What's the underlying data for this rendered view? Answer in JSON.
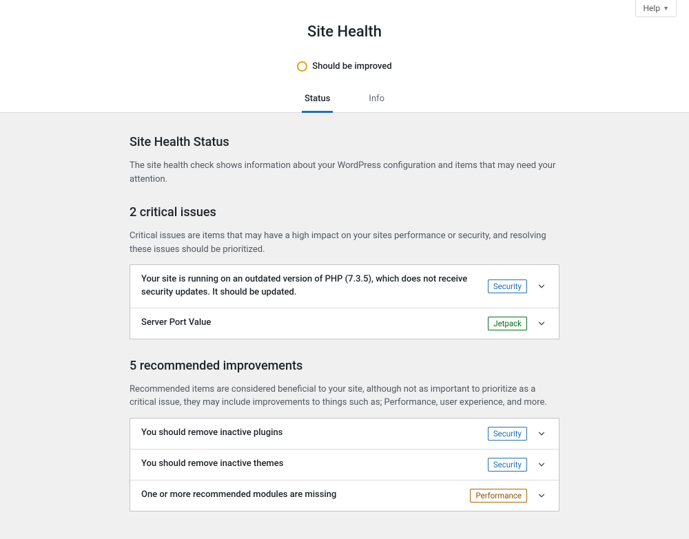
{
  "help_label": "Help",
  "page_title": "Site Health",
  "status_label": "Should be improved",
  "tabs": {
    "status": "Status",
    "info": "Info"
  },
  "sections": {
    "overview": {
      "title": "Site Health Status",
      "desc": "The site health check shows information about your WordPress configuration and items that may need your attention."
    },
    "critical": {
      "title": "2 critical issues",
      "desc": "Critical issues are items that may have a high impact on your sites performance or security, and resolving these issues should be prioritized.",
      "items": [
        {
          "title": "Your site is running on an outdated version of PHP (7.3.5), which does not receive security updates. It should be updated.",
          "badge": "Security",
          "badge_class": "blue"
        },
        {
          "title": "Server Port Value",
          "badge": "Jetpack",
          "badge_class": "green"
        }
      ]
    },
    "recommended": {
      "title": "5 recommended improvements",
      "desc": "Recommended items are considered beneficial to your site, although not as important to prioritize as a critical issue, they may include improvements to things such as; Performance, user experience, and more.",
      "items": [
        {
          "title": "You should remove inactive plugins",
          "badge": "Security",
          "badge_class": "blue"
        },
        {
          "title": "You should remove inactive themes",
          "badge": "Security",
          "badge_class": "blue"
        },
        {
          "title": "One or more recommended modules are missing",
          "badge": "Performance",
          "badge_class": "orange"
        }
      ]
    }
  }
}
